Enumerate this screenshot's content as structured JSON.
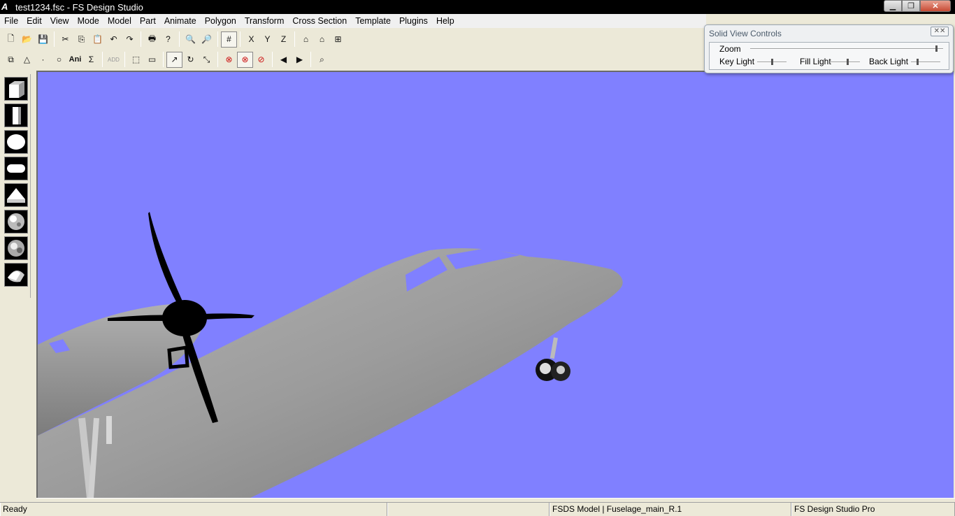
{
  "window": {
    "title": "test1234.fsc - FS Design Studio",
    "app_icon_glyph": "A",
    "min_glyph": "▁",
    "max_glyph": "❐",
    "close_glyph": "✕"
  },
  "menu": [
    "File",
    "Edit",
    "View",
    "Mode",
    "Model",
    "Part",
    "Animate",
    "Polygon",
    "Transform",
    "Cross Section",
    "Template",
    "Plugins",
    "Help"
  ],
  "toolbar1": {
    "new": "🗋",
    "open": "📂",
    "save": "💾",
    "cut": "✂",
    "copy": "⎘",
    "paste": "📋",
    "undo": "↶",
    "redo": "↷",
    "print": "🖶",
    "help": "?",
    "zoom_in": "🔍",
    "zoom_out": "🔎",
    "grid": "#",
    "axis_x": "X",
    "axis_y": "Y",
    "axis_z": "Z",
    "view1": "⌂",
    "view2": "⌂",
    "view3": "⊞"
  },
  "toolbar2": {
    "tool1": "⧉",
    "tool2": "△",
    "tool3": "·",
    "tool4": "○",
    "ani": "Ani",
    "sum": "Σ",
    "add": "ADD",
    "sel1": "⬚",
    "sel2": "▭",
    "move": "↗",
    "rotate": "↻",
    "scale": "⤡",
    "x1": "⊗",
    "x2": "⊗",
    "x3": "⊘",
    "prev": "◀",
    "next": "▶",
    "find": "⌕"
  },
  "solid_view_controls": {
    "title": "Solid View Controls",
    "close_glyph": "✕✕",
    "zoom_label": "Zoom",
    "key_light_label": "Key Light",
    "fill_light_label": "Fill Light",
    "back_light_label": "Back Light",
    "zoom_value": 0.97,
    "key_light_value": 0.5,
    "fill_light_value": 0.6,
    "back_light_value": 0.2
  },
  "status": {
    "ready": "Ready",
    "model_info": "FSDS Model | Fuselage_main_R.1",
    "product": "FS Design Studio Pro"
  },
  "colors": {
    "viewport_bg": "#8080ff",
    "fuselage": "#9a9a9a",
    "propeller": "#000000"
  }
}
